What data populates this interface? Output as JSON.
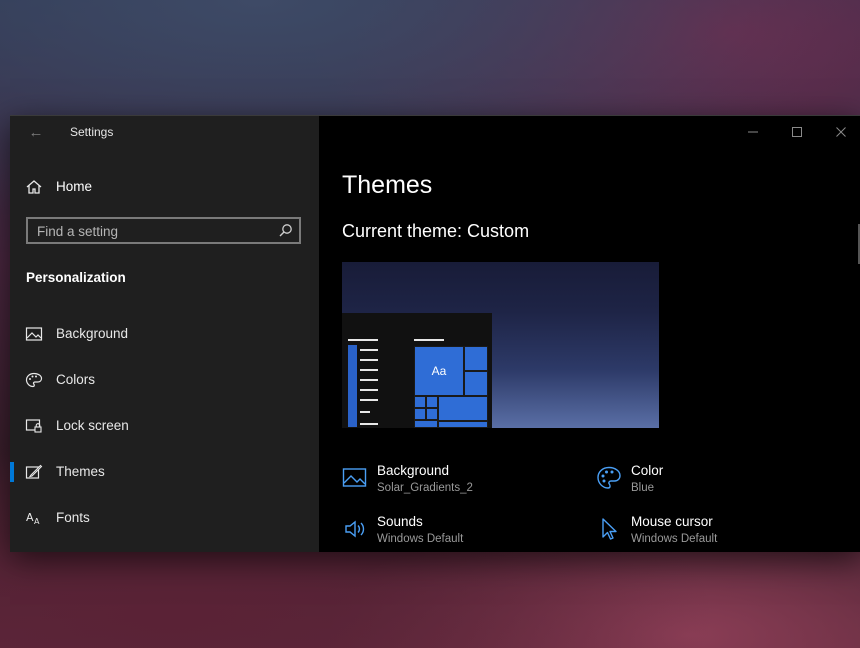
{
  "app": {
    "title": "Settings",
    "back_glyph": "←",
    "window_controls": {
      "minimize": "minimize-icon",
      "maximize": "maximize-icon",
      "close": "close-icon"
    }
  },
  "sidebar": {
    "home_label": "Home",
    "search_placeholder": "Find a setting",
    "section_title": "Personalization",
    "items": [
      {
        "label": "Background",
        "icon": "picture-icon",
        "selected": false
      },
      {
        "label": "Colors",
        "icon": "palette-icon",
        "selected": false
      },
      {
        "label": "Lock screen",
        "icon": "lock-screen-icon",
        "selected": false
      },
      {
        "label": "Themes",
        "icon": "themes-icon",
        "selected": true
      },
      {
        "label": "Fonts",
        "icon": "fonts-icon",
        "selected": false
      }
    ]
  },
  "main": {
    "title": "Themes",
    "current_theme": "Current theme: Custom",
    "preview": {
      "tile_text": "Aa"
    },
    "properties": [
      {
        "name": "Background",
        "value": "Solar_Gradients_2",
        "icon": "picture-icon"
      },
      {
        "name": "Color",
        "value": "Blue",
        "icon": "palette-icon"
      },
      {
        "name": "Sounds",
        "value": "Windows Default",
        "icon": "speaker-icon"
      },
      {
        "name": "Mouse cursor",
        "value": "Windows Default",
        "icon": "cursor-icon"
      }
    ]
  },
  "colors": {
    "accent": "#0078d7",
    "icon_blue": "#4a9ff5"
  }
}
